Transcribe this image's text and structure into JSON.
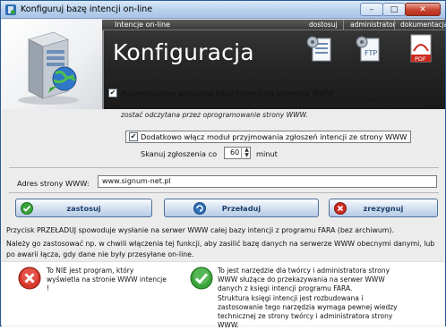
{
  "window": {
    "title": "Konfiguruj bazę intencji on-line",
    "buttons": {
      "minimize": "–",
      "maximize": "□",
      "close": "✕"
    }
  },
  "header": {
    "subtitle": "Intencje on-line",
    "nav": [
      "dostosuj",
      "administrator",
      "dokumentacja"
    ],
    "title": "Konfiguracja",
    "icons": [
      "settings-doc-icon",
      "ftp-icon",
      "pdf-icon"
    ],
    "icon_labels": {
      "ftp": "FTP",
      "pdf": "PDF"
    }
  },
  "settings": {
    "auto_update": {
      "checked": true,
      "label": "Automatycznie aktualizuj bazę intencji na serwerze WWW",
      "note": "Każdorazowa zmiana intencji będzie natychmiast wysyłana na serwer WWW, gdzie musi zostać odczytana przez oprogramowanie strony WWW."
    },
    "extra_module": {
      "checked": true,
      "label": "Dodatkowo włącz moduł przyjmowania zgłoszeń intencji ze strony WWW"
    },
    "scan": {
      "label": "Skanuj zgłoszenia co",
      "value": "60",
      "unit": "minut"
    },
    "url": {
      "label": "Adres strony WWW:",
      "value": "www.signum-net.pl"
    }
  },
  "buttons": {
    "apply": "zastosuj",
    "reload": "Przeładuj",
    "cancel": "zrezygnuj"
  },
  "info": {
    "line1": "Przycisk PRZEŁADUJ spowoduje wysłanie na serwer WWW całej bazy intencji z programu FARA (bez archiwum).",
    "line2": "Należy go zastosować np. w chwili włączenia tej funkcji, aby zasilić bazę danych na serwerze WWW obecnymi danymi, lub po awarii łącza, gdy dane nie były przesyłane on-line."
  },
  "panels": {
    "no": "To NIE jest program, który wyświetla na stronie WWW intencje !",
    "yes_1": "To jest narzędzie dla twórcy i administratora strony WWW służące do przekazywania na serwer WWW danych z księgi intencji programu FARA.",
    "yes_2": "Struktura księgi intencji jest rozbudowana i zastosowanie tego narzędzia wymaga pewnej wiedzy technicznej ze strony twórcy i administratora strony WWW."
  },
  "colors": {
    "titlebar": "#b8d0ec",
    "header_bg": "#262626",
    "accent_green": "#3aa33a",
    "accent_red": "#cc2a1e",
    "button_text": "#1c3f6e"
  }
}
